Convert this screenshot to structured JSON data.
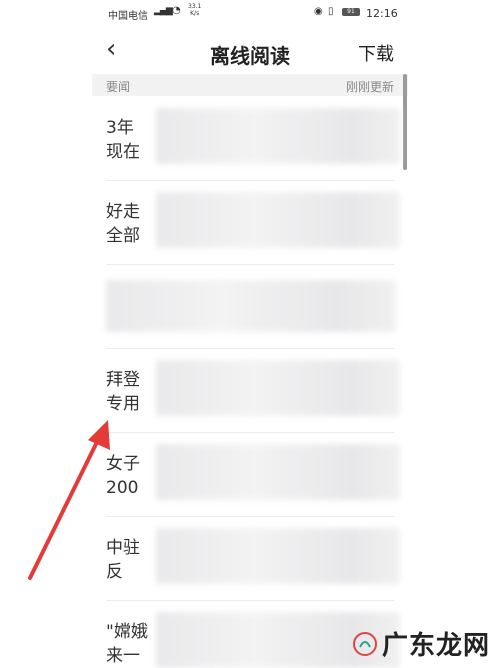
{
  "status_bar": {
    "carrier": "中国电信",
    "network_speed": "33.1\nK/s",
    "battery": "91",
    "time": "12:16"
  },
  "nav_bar": {
    "back_icon": "chevron-left-icon",
    "title": "离线阅读",
    "download_label": "下载"
  },
  "section": {
    "label": "要闻",
    "status": "刚刚更新"
  },
  "news_items": [
    {
      "text": "3年\n现在"
    },
    {
      "text": "好走\n全部"
    },
    {
      "text": ""
    },
    {
      "text": "拜登\n专用"
    },
    {
      "text": "女子\n200"
    },
    {
      "text": "中驻\n反"
    },
    {
      "text": "\"嫦娥\n来一"
    }
  ],
  "annotation": {
    "arrow_color": "#e53a3a"
  },
  "watermark": {
    "text": "广东龙网"
  }
}
